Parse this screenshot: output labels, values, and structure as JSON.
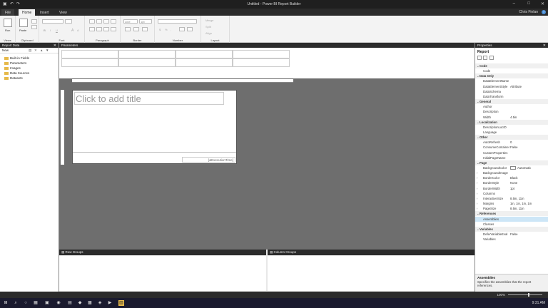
{
  "window": {
    "title": "Untitled - Power BI Report Builder",
    "minimize": "–",
    "maximize": "□",
    "close": "✕"
  },
  "ribbon": {
    "tabs": [
      "File",
      "Home",
      "Insert",
      "View"
    ],
    "active_tab": "Home",
    "user": "Chris Finlan",
    "help": "?",
    "groups": {
      "views": {
        "label": "Views",
        "run": "Run"
      },
      "clipboard": {
        "label": "Clipboard",
        "paste": "Paste"
      },
      "font": {
        "label": "Font",
        "bold": "B",
        "italic": "I",
        "underline": "U",
        "font_size_up": "A",
        "font_size_down": "A"
      },
      "paragraph": {
        "label": "Paragraph"
      },
      "border": {
        "label": "Border",
        "style": "Line",
        "width": "1pt"
      },
      "number": {
        "label": "Number",
        "currency": "$",
        "percent": "%",
        "comma": ","
      },
      "layout": {
        "label": "Layout",
        "merge": "Merge",
        "split": "Split",
        "align": "Align"
      }
    }
  },
  "report_data": {
    "title": "Report Data",
    "new_label": "New",
    "items": [
      "Built-in Fields",
      "Parameters",
      "Images",
      "Data Sources",
      "Datasets"
    ]
  },
  "parameters": {
    "title": "Parameters"
  },
  "design": {
    "title_placeholder": "Click to add title",
    "exec_time": "[&ExecutionTime]"
  },
  "groups": {
    "row": "Row Groups",
    "column": "Column Groups"
  },
  "properties": {
    "title": "Properties",
    "object": "Report",
    "rows": [
      {
        "type": "cat",
        "key": "Code"
      },
      {
        "type": "prop",
        "key": "Code",
        "value": ""
      },
      {
        "type": "cat",
        "key": "Data Only"
      },
      {
        "type": "prop",
        "key": "DataElementName",
        "value": ""
      },
      {
        "type": "prop",
        "key": "DataElementStyle",
        "value": "Attribute"
      },
      {
        "type": "prop",
        "key": "DataSchema",
        "value": ""
      },
      {
        "type": "prop",
        "key": "DataTransform",
        "value": ""
      },
      {
        "type": "cat",
        "key": "General"
      },
      {
        "type": "prop",
        "key": "Author",
        "value": ""
      },
      {
        "type": "prop",
        "key": "Description",
        "value": ""
      },
      {
        "type": "prop",
        "key": "Width",
        "value": "4.5in"
      },
      {
        "type": "cat",
        "key": "Localization"
      },
      {
        "type": "prop",
        "key": "DescriptionLocID",
        "value": ""
      },
      {
        "type": "prop",
        "key": "Language",
        "value": ""
      },
      {
        "type": "cat",
        "key": "Other"
      },
      {
        "type": "prop",
        "key": "AutoRefresh",
        "value": "0"
      },
      {
        "type": "prop",
        "key": "ConsumeContainer",
        "value": "False"
      },
      {
        "type": "prop",
        "key": "CustomProperties",
        "value": ""
      },
      {
        "type": "prop",
        "key": "InitialPageName",
        "value": ""
      },
      {
        "type": "cat",
        "key": "Page"
      },
      {
        "type": "prop",
        "key": "BackgroundColor",
        "value": "Automatic",
        "swatch": true
      },
      {
        "type": "prop",
        "key": "BackgroundImage",
        "value": "",
        "expand": true
      },
      {
        "type": "prop",
        "key": "BorderColor",
        "value": "Black",
        "expand": true
      },
      {
        "type": "prop",
        "key": "BorderStyle",
        "value": "None",
        "expand": true
      },
      {
        "type": "prop",
        "key": "BorderWidth",
        "value": "1pt",
        "expand": true
      },
      {
        "type": "prop",
        "key": "Columns",
        "value": "",
        "expand": true
      },
      {
        "type": "prop",
        "key": "InteractiveSize",
        "value": "8.5in, 11in",
        "expand": true
      },
      {
        "type": "prop",
        "key": "Margins",
        "value": "1in, 1in, 1in, 1in",
        "expand": true
      },
      {
        "type": "prop",
        "key": "PageSize",
        "value": "8.5in, 11in",
        "expand": true
      },
      {
        "type": "cat",
        "key": "References"
      },
      {
        "type": "prop",
        "key": "Assemblies",
        "value": "",
        "selected": true
      },
      {
        "type": "prop",
        "key": "Classes",
        "value": ""
      },
      {
        "type": "cat",
        "key": "Variables"
      },
      {
        "type": "prop",
        "key": "DeferVariableEval",
        "value": "False"
      },
      {
        "type": "prop",
        "key": "Variables",
        "value": ""
      }
    ],
    "desc_title": "Assemblies",
    "desc_text": "Specifies the assemblies that the report references."
  },
  "status": {
    "zoom": "100%"
  },
  "taskbar": {
    "time": "9:31 AM"
  },
  "colors": {
    "chrome": "#2b2b2b",
    "ribbon": "#f3f3f3",
    "canvas": "#6e6e6e",
    "accent": "#4a90d9"
  }
}
